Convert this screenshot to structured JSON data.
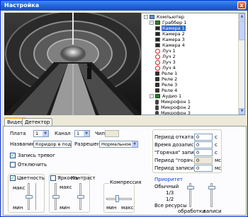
{
  "window": {
    "title": "Настройка",
    "close_glyph": "x"
  },
  "tree": {
    "nodes": [
      {
        "label": "Компьютер",
        "icon": "computer-icon",
        "expander": "-"
      },
      {
        "label": "Граббер 1",
        "icon": "grabber-board-icon",
        "expander": "-"
      },
      {
        "label": "Камера 1",
        "icon": "camera-icon",
        "selected": true
      },
      {
        "label": "Камера 2",
        "icon": "camera-icon"
      },
      {
        "label": "Камера 3",
        "icon": "camera-icon"
      },
      {
        "label": "Камера 4",
        "icon": "camera-icon"
      },
      {
        "label": "Луч 1",
        "icon": "sensor-ray-icon"
      },
      {
        "label": "Луч 2",
        "icon": "sensor-ray-icon"
      },
      {
        "label": "Луч 3",
        "icon": "sensor-ray-icon"
      },
      {
        "label": "Луч 4",
        "icon": "sensor-ray-icon"
      },
      {
        "label": "Реле 1",
        "icon": "relay-icon"
      },
      {
        "label": "Реле 2",
        "icon": "relay-icon"
      },
      {
        "label": "Реле 3",
        "icon": "relay-icon"
      },
      {
        "label": "Реле 4",
        "icon": "relay-icon"
      },
      {
        "label": "Аудио 1",
        "icon": "audio-board-icon",
        "expander": "-"
      },
      {
        "label": "Микрофон 1",
        "icon": "microphone-icon"
      },
      {
        "label": "Микрофон 2",
        "icon": "microphone-icon"
      },
      {
        "label": "Микрофон 3",
        "icon": "microphone-icon"
      }
    ]
  },
  "tabs": [
    {
      "label": "Видео",
      "active": true
    },
    {
      "label": "Детектор",
      "active": false
    }
  ],
  "video": {
    "board_label": "Плата",
    "board_value": "1",
    "channel_label": "Канал",
    "channel_value": "1",
    "chip_label": "Чип",
    "name_label": "Название",
    "name_value": "Коридор в подъезд",
    "resolution_label": "Разрешение",
    "resolution_value": "Нормальное",
    "alarm_record_label": "Запись тревог",
    "alarm_record_checked": true,
    "disable_label": "Отключить",
    "disable_checked": false,
    "color_label": "Цветность",
    "color_checked": true,
    "brightness_label": "Яркость",
    "brightness_checked": false,
    "contrast_label": "Контраст",
    "compression_label": "Компрессия",
    "max_label": "макс",
    "min_label": "мин"
  },
  "timing": {
    "rows": [
      {
        "label": "Период отката",
        "value": "0",
        "unit": "с",
        "disabled": false
      },
      {
        "label": "Время дозаписи",
        "value": "0",
        "unit": "с",
        "disabled": false
      },
      {
        "label": "\"Горячая\" запись",
        "value": "0",
        "unit": "с",
        "disabled": false
      },
      {
        "label": "Период \"горяч.\"",
        "value": "0",
        "unit": "мс",
        "disabled": true
      },
      {
        "label": "Период записи",
        "value": "0",
        "unit": "мс",
        "disabled": false
      }
    ]
  },
  "priority": {
    "title": "Приоритет",
    "options": [
      "Обычный",
      "1/3",
      "1/2",
      "Все ресурсы"
    ],
    "processing_label": "обработки",
    "recording_label": "записи"
  }
}
